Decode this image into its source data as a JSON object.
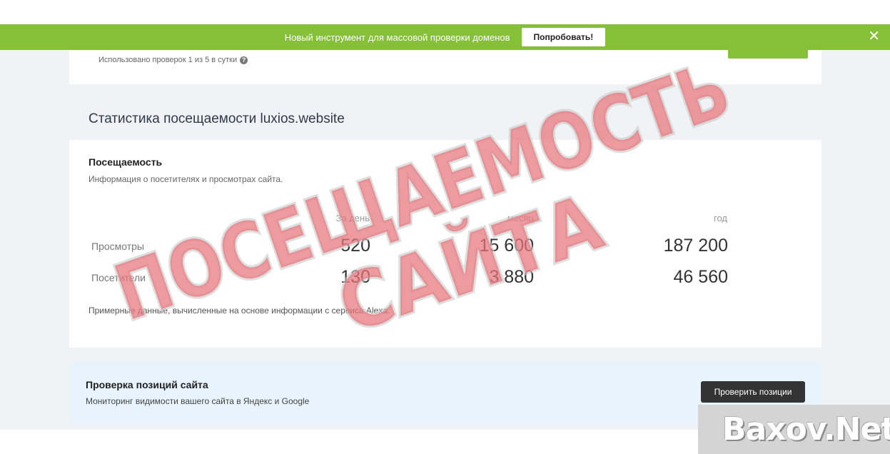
{
  "banner": {
    "text": "Новый инструмент для массовой проверки доменов",
    "button": "Попробовать!",
    "close": "✕",
    "color": "#86c038"
  },
  "limits": {
    "text": "Использовано проверок 1 из 5 в сутки",
    "help_icon": "?"
  },
  "stats": {
    "title": "Статистика посещаемости luxios.website",
    "card_title": "Посещаемость",
    "card_subtitle": "Информация о посетителях и просмотрах сайта.",
    "columns": [
      "За день",
      "месяц",
      "год"
    ],
    "rows": [
      {
        "label": "Просмотры",
        "day": "520",
        "month": "15 600",
        "year": "187 200"
      },
      {
        "label": "Посетители",
        "day": "130",
        "month": "3 880",
        "year": "46 560"
      }
    ],
    "note": "Примерные данные, вычисленные на основе информации с сервиса Alexa."
  },
  "positions": {
    "title": "Проверка позиций сайта",
    "subtitle": "Мониторинг видимости вашего сайта в Яндекс и Google",
    "button": "Проверить позиции"
  },
  "stamp": {
    "line1": "ПОСЕЩАЕМОСТЬ",
    "line2": "САЙТА",
    "color": "#e8747a"
  },
  "watermark": {
    "text": "Baxov.Net"
  }
}
